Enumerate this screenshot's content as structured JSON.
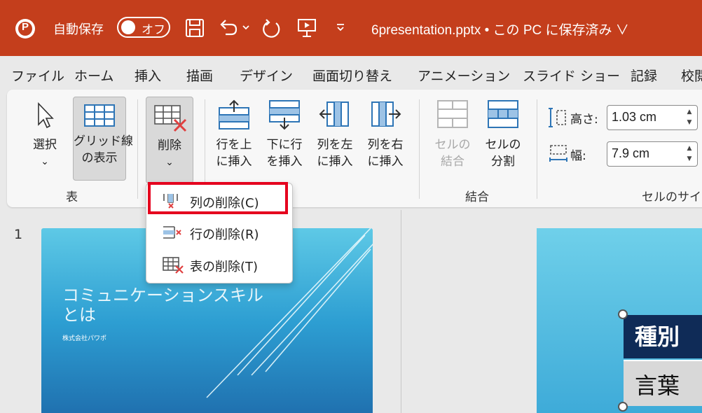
{
  "titlebar": {
    "app_logo": "P",
    "autosave_label": "自動保存",
    "toggle_state": "オフ",
    "file_title": "6presentation.pptx • この PC に保存済み ∨",
    "accent_color": "#c43e1c"
  },
  "menu": [
    "ファイル",
    "ホーム",
    "挿入",
    "描画",
    "デザイン",
    "画面切り替え",
    "アニメーション",
    "スライド ショー",
    "記録",
    "校閲"
  ],
  "ribbon": {
    "select": {
      "line1": "選択",
      "chev": "⌄"
    },
    "gridlines": {
      "line1": "グリッド線",
      "line2": "の表示"
    },
    "group_table": "表",
    "delete": {
      "line1": "削除",
      "chev": "⌄"
    },
    "insert_above": {
      "line1": "行を上",
      "line2": "に挿入"
    },
    "insert_below": {
      "line1": "下に行",
      "line2": "を挿入"
    },
    "insert_left": {
      "line1": "列を左",
      "line2": "に挿入"
    },
    "insert_right": {
      "line1": "列を右",
      "line2": "に挿入"
    },
    "merge_cells": {
      "line1": "セルの",
      "line2": "結合"
    },
    "split_cells": {
      "line1": "セルの",
      "line2": "分割"
    },
    "group_merge": "結合",
    "height_label": "高さ:",
    "height_value": "1.03 cm",
    "width_label": "幅:",
    "width_value": "7.9 cm",
    "group_cellsize": "セルのサイズ"
  },
  "dropdown": {
    "items": [
      {
        "label": "列の削除(C)",
        "icon": "delete-columns-icon"
      },
      {
        "label": "行の削除(R)",
        "icon": "delete-rows-icon"
      },
      {
        "label": "表の削除(T)",
        "icon": "delete-table-icon"
      }
    ],
    "highlight_color": "#e5001e"
  },
  "slides": {
    "number": "1",
    "thumb_title_line1": "コミュニケーションスキル",
    "thumb_title_line2": "とは",
    "thumb_subtitle": "株式会社パワポ"
  },
  "table": {
    "header": "種別",
    "row1": "言葉"
  }
}
